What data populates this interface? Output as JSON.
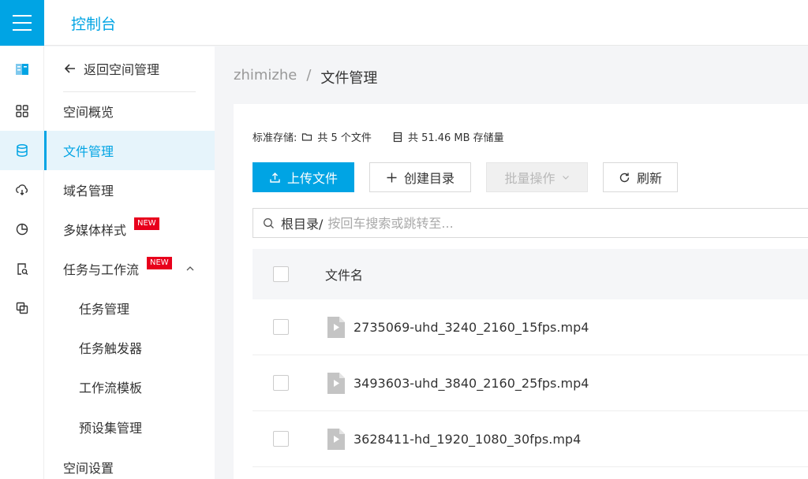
{
  "header": {
    "title": "控制台"
  },
  "sidebar": {
    "back_label": "返回空间管理",
    "items": [
      {
        "label": "空间概览"
      },
      {
        "label": "文件管理"
      },
      {
        "label": "域名管理"
      },
      {
        "label": "多媒体样式",
        "badge": "NEW"
      },
      {
        "label": "任务与工作流",
        "badge": "NEW"
      },
      {
        "label": "任务管理"
      },
      {
        "label": "任务触发器"
      },
      {
        "label": "工作流模板"
      },
      {
        "label": "预设集管理"
      },
      {
        "label": "空间设置"
      }
    ]
  },
  "rail_icons": [
    "storage-logo-icon",
    "grid-icon",
    "database-icon",
    "cloud-sync-icon",
    "pie-chart-icon",
    "file-search-icon",
    "transfer-icon"
  ],
  "breadcrumb": {
    "space": "zhimizhe",
    "separator": "/",
    "current": "文件管理"
  },
  "stats": {
    "label": "标准存储:",
    "file_count": "共 5 个文件",
    "storage": "共 51.46 MB 存储量"
  },
  "toolbar": {
    "upload": "上传文件",
    "create_dir": "创建目录",
    "batch": "批量操作",
    "refresh": "刷新"
  },
  "search": {
    "root": "根目录/",
    "placeholder": "按回车搜索或跳转至..."
  },
  "table": {
    "column_name": "文件名",
    "rows": [
      {
        "name": "2735069-uhd_3240_2160_15fps.mp4"
      },
      {
        "name": "3493603-uhd_3840_2160_25fps.mp4"
      },
      {
        "name": "3628411-hd_1920_1080_30fps.mp4"
      }
    ]
  },
  "colors": {
    "accent": "#00a4e4",
    "badge": "#e8001c"
  }
}
